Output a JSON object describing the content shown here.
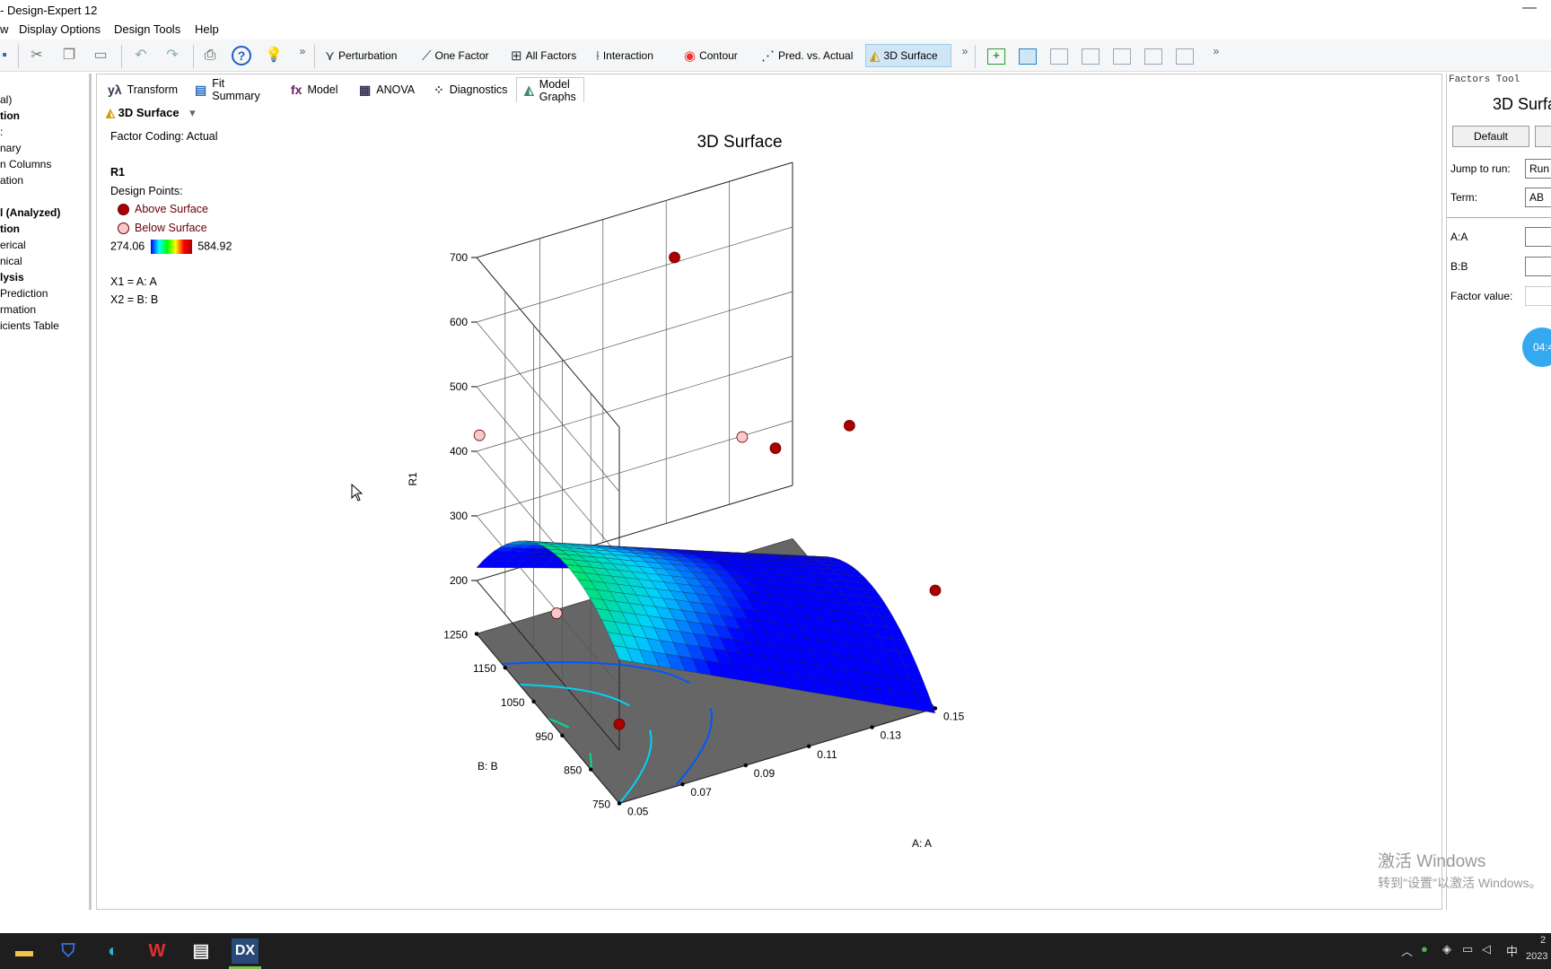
{
  "window": {
    "title": "- Design-Expert 12",
    "minimize_glyph": "—"
  },
  "menu": [
    "w",
    "Display Options",
    "Design Tools",
    "Help"
  ],
  "toolbar": {
    "buttons": [
      {
        "label": "Perturbation",
        "icon": "perturbation-icon"
      },
      {
        "label": "One Factor",
        "icon": "one-factor-icon"
      },
      {
        "label": "All Factors",
        "icon": "all-factors-icon"
      },
      {
        "label": "Interaction",
        "icon": "interaction-icon"
      },
      {
        "label": "Contour",
        "icon": "contour-icon"
      },
      {
        "label": "Pred. vs. Actual",
        "icon": "pred-vs-actual-icon"
      },
      {
        "label": "3D Surface",
        "icon": "3d-surface-icon",
        "active": true
      }
    ],
    "overflow_glyph": "»"
  },
  "sidebar": {
    "items": [
      {
        "label": "al)",
        "bold": false
      },
      {
        "label": "tion",
        "bold": true
      },
      {
        "label": ":",
        "bold": false
      },
      {
        "label": "nary",
        "bold": false
      },
      {
        "label": "n Columns",
        "bold": false
      },
      {
        "label": "ation",
        "bold": false
      },
      {
        "label": "l (Analyzed)",
        "bold": true
      },
      {
        "label": "tion",
        "bold": true
      },
      {
        "label": "erical",
        "bold": false
      },
      {
        "label": "nical",
        "bold": false
      },
      {
        "label": "lysis",
        "bold": true
      },
      {
        "label": " Prediction",
        "bold": false
      },
      {
        "label": "rmation",
        "bold": false
      },
      {
        "label": "icients Table",
        "bold": false
      }
    ]
  },
  "tabs": [
    {
      "label": "Transform",
      "icon": "yλ"
    },
    {
      "label": "Fit Summary",
      "icon": "▤"
    },
    {
      "label": "Model",
      "icon": "fx"
    },
    {
      "label": "ANOVA",
      "icon": "▦"
    },
    {
      "label": "Diagnostics",
      "icon": "⁘"
    },
    {
      "label": "Model Graphs",
      "icon": "◭",
      "active": true
    }
  ],
  "graph_selector": {
    "label": "3D Surface",
    "arrow": "▾"
  },
  "legend": {
    "coding": "Factor Coding: Actual",
    "response": "R1",
    "design_points_title": "Design Points:",
    "above": "Above Surface",
    "below": "Below Surface",
    "scale_min": "274.06",
    "scale_max": "584.92",
    "x1": "X1 = A: A",
    "x2": "X2 = B: B",
    "above_color": "#aa0000",
    "below_color": "#f7c9cc"
  },
  "chart_data": {
    "type": "surface",
    "title": "3D Surface",
    "xlabel": "A: A",
    "ylabel": "B: B",
    "zlabel": "R1",
    "xlim": [
      0.05,
      0.15
    ],
    "ylim": [
      750,
      1250
    ],
    "zlim": [
      200,
      700
    ],
    "x_ticks": [
      "0.05",
      "0.07",
      "0.09",
      "0.11",
      "0.13",
      "0.15"
    ],
    "y_ticks": [
      "750",
      "850",
      "950",
      "1050",
      "1150",
      "1250"
    ],
    "z_ticks": [
      "200",
      "300",
      "400",
      "500",
      "600",
      "700"
    ],
    "color_range": [
      274.06,
      584.92
    ],
    "grid": true
  },
  "factors_tool": {
    "header": "Factors Tool",
    "title": "3D Surfa",
    "default_button": "Default",
    "jump_label": "Jump to run:",
    "jump_value": "Run #",
    "term_label": "Term:",
    "term_value": "AB",
    "a_label": "A:A",
    "b_label": "B:B",
    "factor_value_label": "Factor value:",
    "timer": "04:4"
  },
  "watermark": {
    "line1": "激活 Windows",
    "line2": "转到\"设置\"以激活 Windows。"
  },
  "taskbar": {
    "apps": [
      "file-explorer-icon",
      "security-icon",
      "edge-icon",
      "wps-icon",
      "media-icon",
      "design-expert-icon"
    ],
    "dx_label": "DX",
    "ime": "中",
    "clock_line1": "2",
    "clock_line2": "2023"
  }
}
